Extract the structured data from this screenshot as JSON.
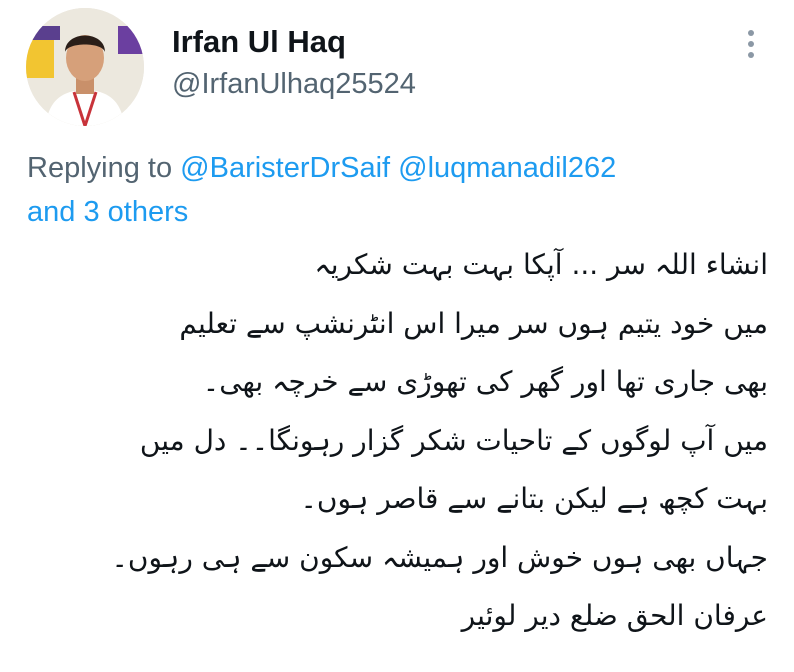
{
  "author": {
    "display_name": "Irfan Ul Haq",
    "handle": "@IrfanUlhaq25524",
    "avatar_icon": "profile-photo"
  },
  "reply": {
    "prefix": "Replying to ",
    "mentions": [
      "@BaristerDrSaif",
      "@luqmanadil262"
    ],
    "others": "and 3 others"
  },
  "body_lines": [
    "انشاء اللہ سر ... آپکا بہت بہت شکریہ",
    "میں خود یتیم ہوں سر میرا اس انٹرنشپ سے تعلیم",
    "بھی جاری تھا اور گھر کی تھوڑی سے خرچہ بھی۔",
    "میں آپ لوگوں کے تاحیات شکر گزار رہونگا۔۔ دل میں",
    "بہت کچھ ہے لیکن بتانے سے قاصر ہوں۔",
    "جہاں بھی ہوں خوش اور ہمیشہ سکون سے ہی رہوں۔",
    "عرفان الحق ضلع دیر لوئیر"
  ],
  "more_icon": "more-vertical-icon",
  "colors": {
    "link": "#1d9bf0",
    "secondary": "#536471",
    "text": "#0f1419"
  }
}
